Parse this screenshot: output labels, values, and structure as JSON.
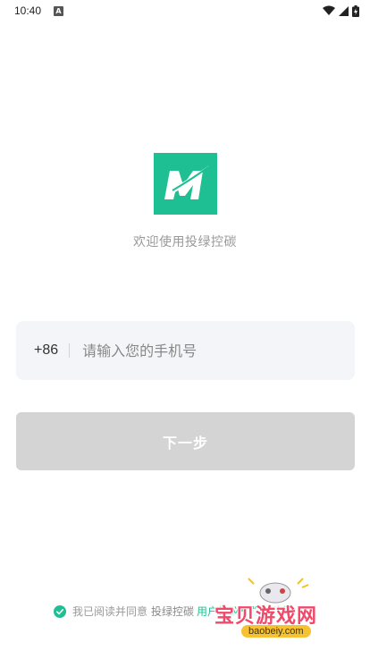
{
  "status_bar": {
    "time": "10:40",
    "notification_letter": "A"
  },
  "welcome_text": "欢迎使用投绿控碳",
  "phone": {
    "country_code": "+86",
    "placeholder": "请输入您的手机号",
    "value": ""
  },
  "next_button_label": "下一步",
  "agreement": {
    "prefix": "我已阅读并同意",
    "brand": "投绿控碳",
    "link": "用户协议和隐私政策",
    "checked": true
  },
  "watermark": {
    "title": "宝贝游戏网",
    "url": "baobeiy.com"
  },
  "colors": {
    "accent": "#1fbf94",
    "button_disabled": "#d4d4d4",
    "input_bg": "#f4f5f9"
  }
}
